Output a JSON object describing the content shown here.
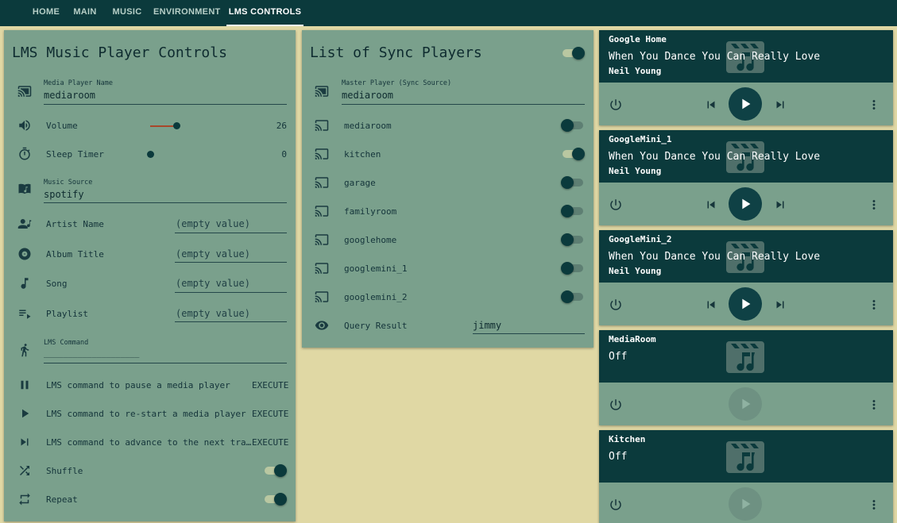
{
  "nav": {
    "tabs": [
      {
        "label": "HOME"
      },
      {
        "label": "MAIN"
      },
      {
        "label": "MUSIC"
      },
      {
        "label": "ENVIRONMENT"
      },
      {
        "label": "LMS CONTROLS"
      }
    ],
    "active_tab": "LMS CONTROLS"
  },
  "lms_card": {
    "title": "LMS Music Player Controls",
    "media_player": {
      "label": "Media Player Name",
      "value": "mediaroom"
    },
    "volume": {
      "label": "Volume",
      "value": "26",
      "level": 0.26
    },
    "sleep_timer": {
      "label": "Sleep Timer",
      "value": "0",
      "level": 0
    },
    "music_source": {
      "label": "Music Source",
      "value": "spotify"
    },
    "artist": {
      "label": "Artist Name",
      "placeholder": "(empty value)"
    },
    "album": {
      "label": "Album Title",
      "placeholder": "(empty value)"
    },
    "song": {
      "label": "Song",
      "placeholder": "(empty value)"
    },
    "playlist": {
      "label": "Playlist",
      "placeholder": "(empty value)"
    },
    "lms_command": {
      "label": "LMS Command",
      "value": "____________________"
    },
    "scripts": [
      {
        "label": "LMS command to pause a media player",
        "action": "EXECUTE"
      },
      {
        "label": "LMS command to re-start a media player",
        "action": "EXECUTE"
      },
      {
        "label": "LMS command to advance to the next tra…",
        "action": "EXECUTE"
      }
    ],
    "shuffle": {
      "label": "Shuffle",
      "on": true
    },
    "repeat": {
      "label": "Repeat",
      "on": true
    }
  },
  "sync_card": {
    "title": "List of Sync Players",
    "master_toggle_on": true,
    "master": {
      "label": "Master Player (Sync Source)",
      "value": "mediaroom"
    },
    "players": [
      {
        "name": "mediaroom",
        "on": false
      },
      {
        "name": "kitchen",
        "on": true
      },
      {
        "name": "garage",
        "on": false
      },
      {
        "name": "familyroom",
        "on": false
      },
      {
        "name": "googlehome",
        "on": false
      },
      {
        "name": "googlemini_1",
        "on": false
      },
      {
        "name": "googlemini_2",
        "on": false
      }
    ],
    "query": {
      "label": "Query Result",
      "value": "jimmy"
    }
  },
  "media_players": [
    {
      "name": "Google Home",
      "title": "When You Dance You Can Really Love",
      "artist": "Neil Young",
      "state": "playing"
    },
    {
      "name": "GoogleMini_1",
      "title": "When You Dance You Can Really Love",
      "artist": "Neil Young",
      "state": "playing"
    },
    {
      "name": "GoogleMini_2",
      "title": "When You Dance You Can Really Love",
      "artist": "Neil Young",
      "state": "playing"
    },
    {
      "name": "MediaRoom",
      "title": "Off",
      "artist": "",
      "state": "off"
    },
    {
      "name": "Kitchen",
      "title": "Off",
      "artist": "",
      "state": "off"
    }
  ],
  "colors": {
    "background": "#e0d8a4",
    "topbar": "#0b3a3c",
    "card": "#7aa08c",
    "accent": "#0b3a3c",
    "slider": "#a8472a"
  }
}
